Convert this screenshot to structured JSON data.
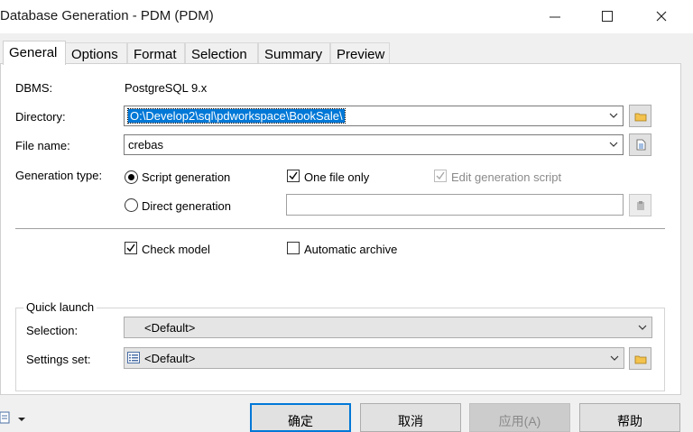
{
  "window": {
    "title": "Database Generation - PDM (PDM)"
  },
  "tabs": [
    {
      "label": "General"
    },
    {
      "label": "Options"
    },
    {
      "label": "Format"
    },
    {
      "label": "Selection"
    },
    {
      "label": "Summary"
    },
    {
      "label": "Preview"
    }
  ],
  "general": {
    "dbms_label": "DBMS:",
    "dbms_value": "PostgreSQL 9.x",
    "directory_label": "Directory:",
    "directory_value": "O:\\Develop2\\sql\\pdworkspace\\BookSale\\",
    "filename_label": "File name:",
    "filename_value": "crebas",
    "gentype_label": "Generation type:",
    "script_generation": "Script generation",
    "direct_generation": "Direct generation",
    "one_file_only": "One file only",
    "edit_generation_script": "Edit generation script",
    "check_model": "Check model",
    "automatic_archive": "Automatic archive"
  },
  "quick_launch": {
    "title": "Quick launch",
    "selection_label": "Selection:",
    "selection_value": "<Default>",
    "settings_label": "Settings set:",
    "settings_value": "<Default>"
  },
  "buttons": {
    "ok": "确定",
    "cancel": "取消",
    "apply": "应用(A)",
    "help": "帮助"
  },
  "states": {
    "script_generation_selected": true,
    "one_file_only_checked": true,
    "edit_generation_script_checked": true,
    "check_model_checked": true,
    "automatic_archive_checked": false
  }
}
